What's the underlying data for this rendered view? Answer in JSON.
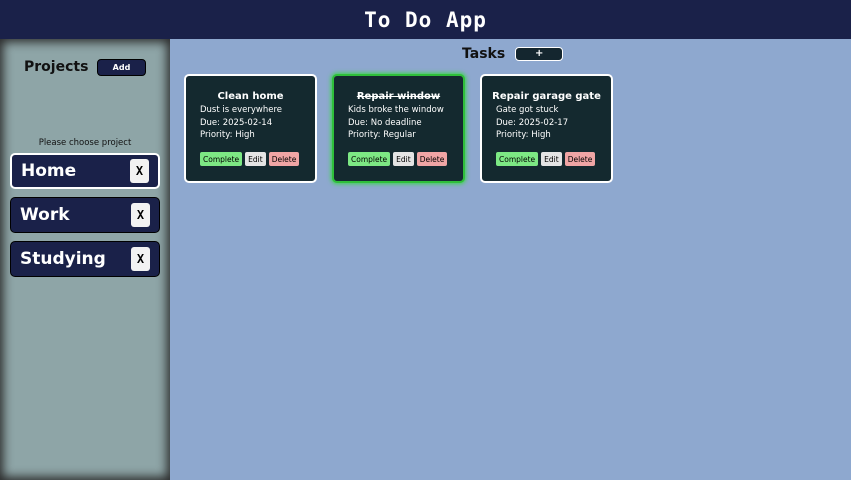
{
  "header": {
    "title": "To Do App"
  },
  "sidebar": {
    "title": "Projects",
    "add_label": "Add",
    "hint": "Please choose project",
    "delete_label": "X",
    "projects": [
      {
        "label": "Home",
        "active": true
      },
      {
        "label": "Work",
        "active": false
      },
      {
        "label": "Studying",
        "active": false
      }
    ]
  },
  "main": {
    "title": "Tasks",
    "add_label": "+",
    "tasks": [
      {
        "title": "Clean home",
        "description": "Dust is everywhere",
        "due": "Due: 2025-02-14",
        "priority": "Priority: High",
        "completed": false
      },
      {
        "title": "Repair window",
        "description": "Kids broke the window",
        "due": "Due: No deadline",
        "priority": "Priority: Regular",
        "completed": true
      },
      {
        "title": "Repair garage gate",
        "description": "Gate got stuck",
        "due": "Due: 2025-02-17",
        "priority": "Priority: High",
        "completed": false
      }
    ],
    "actions": {
      "complete": "Complete",
      "edit": "Edit",
      "delete": "Delete"
    }
  },
  "colors": {
    "header": "#1a2149",
    "sidebar": "#8ea5a7",
    "main": "#8ea8cf",
    "card": "#14292f",
    "complete": "#7de884",
    "delete": "#f0a5a5",
    "completed_border": "#2fbf3a"
  }
}
